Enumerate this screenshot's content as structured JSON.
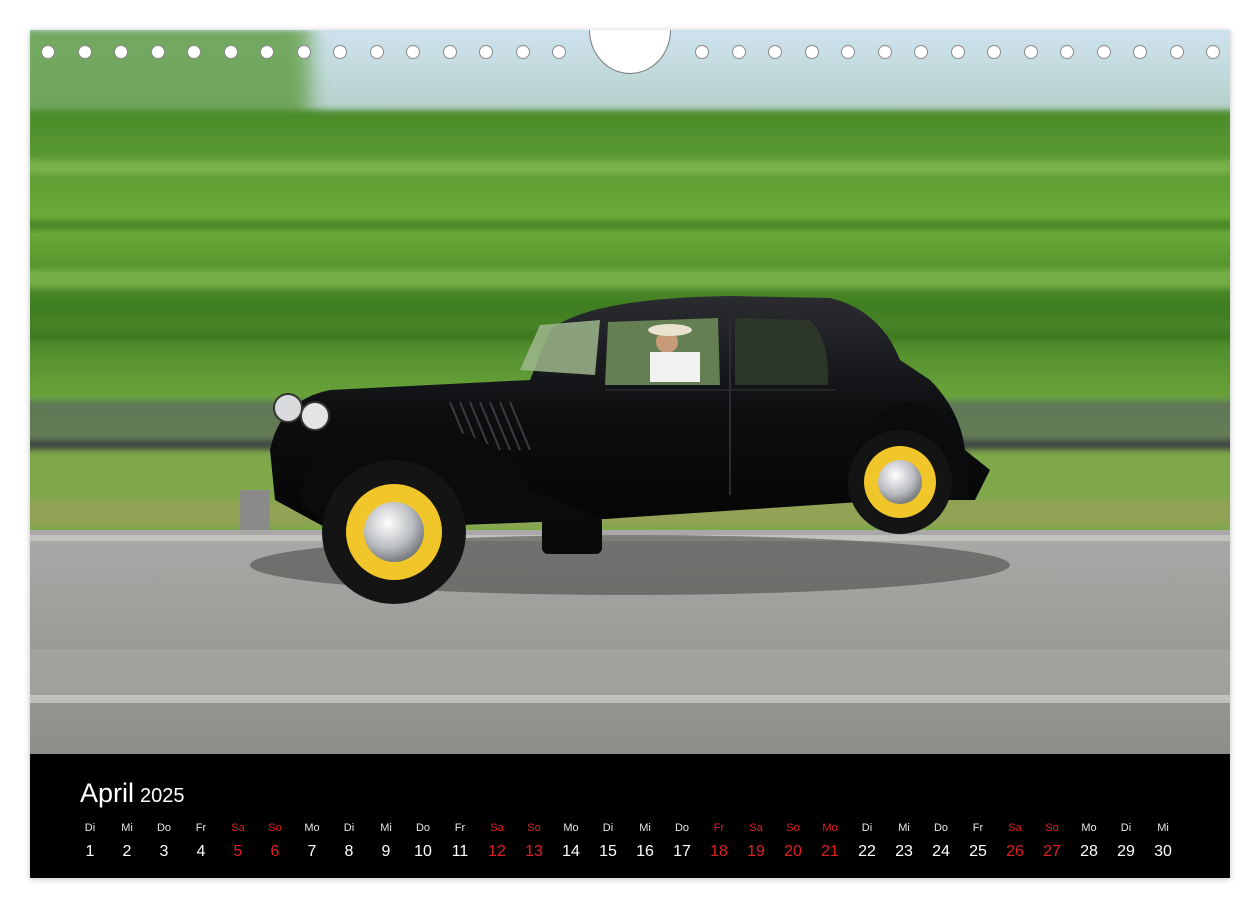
{
  "calendar": {
    "month": "April",
    "year": "2025"
  },
  "days": [
    {
      "wd": "Di",
      "d": "1",
      "red": false
    },
    {
      "wd": "Mi",
      "d": "2",
      "red": false
    },
    {
      "wd": "Do",
      "d": "3",
      "red": false
    },
    {
      "wd": "Fr",
      "d": "4",
      "red": false
    },
    {
      "wd": "Sa",
      "d": "5",
      "red": true
    },
    {
      "wd": "So",
      "d": "6",
      "red": true
    },
    {
      "wd": "Mo",
      "d": "7",
      "red": false
    },
    {
      "wd": "Di",
      "d": "8",
      "red": false
    },
    {
      "wd": "Mi",
      "d": "9",
      "red": false
    },
    {
      "wd": "Do",
      "d": "10",
      "red": false
    },
    {
      "wd": "Fr",
      "d": "11",
      "red": false
    },
    {
      "wd": "Sa",
      "d": "12",
      "red": true
    },
    {
      "wd": "So",
      "d": "13",
      "red": true
    },
    {
      "wd": "Mo",
      "d": "14",
      "red": false
    },
    {
      "wd": "Di",
      "d": "15",
      "red": false
    },
    {
      "wd": "Mi",
      "d": "16",
      "red": false
    },
    {
      "wd": "Do",
      "d": "17",
      "red": false
    },
    {
      "wd": "Fr",
      "d": "18",
      "red": true
    },
    {
      "wd": "Sa",
      "d": "19",
      "red": true
    },
    {
      "wd": "So",
      "d": "20",
      "red": true
    },
    {
      "wd": "Mo",
      "d": "21",
      "red": true
    },
    {
      "wd": "Di",
      "d": "22",
      "red": false
    },
    {
      "wd": "Mi",
      "d": "23",
      "red": false
    },
    {
      "wd": "Do",
      "d": "24",
      "red": false
    },
    {
      "wd": "Fr",
      "d": "25",
      "red": false
    },
    {
      "wd": "Sa",
      "d": "26",
      "red": true
    },
    {
      "wd": "So",
      "d": "27",
      "red": true
    },
    {
      "wd": "Mo",
      "d": "28",
      "red": false
    },
    {
      "wd": "Di",
      "d": "29",
      "red": false
    },
    {
      "wd": "Mi",
      "d": "30",
      "red": false
    }
  ],
  "colors": {
    "holiday": "#e02020",
    "background": "#000000",
    "text": "#ffffff"
  },
  "photo": {
    "icon": "vintage-car-photo"
  }
}
